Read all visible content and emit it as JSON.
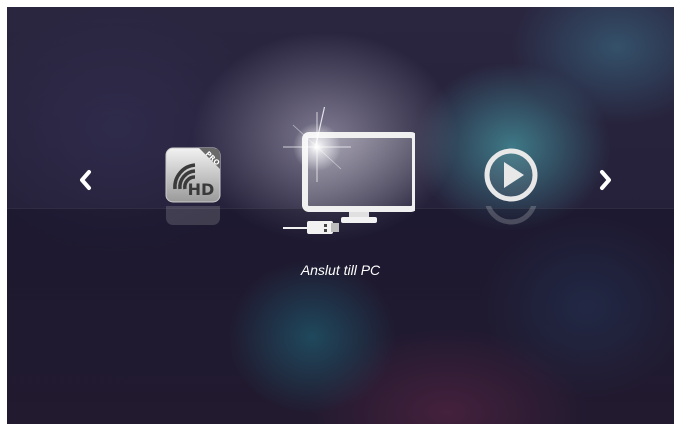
{
  "navigation": {
    "prev_icon": "chevron-left-icon",
    "next_icon": "chevron-right-icon"
  },
  "apps": [
    {
      "id": "wifi-hd-pro",
      "icon": "wifi-hd-pro-icon",
      "badge": "PRO",
      "glyph_text": "HD"
    },
    {
      "id": "connect-pc",
      "icon": "monitor-usb-icon",
      "selected": true
    },
    {
      "id": "media-player",
      "icon": "play-circle-icon"
    }
  ],
  "selected_label": "Anslut till PC",
  "colors": {
    "text": "#ffffff",
    "background": "#1f1c33",
    "accent_teal": "#4696a0"
  }
}
